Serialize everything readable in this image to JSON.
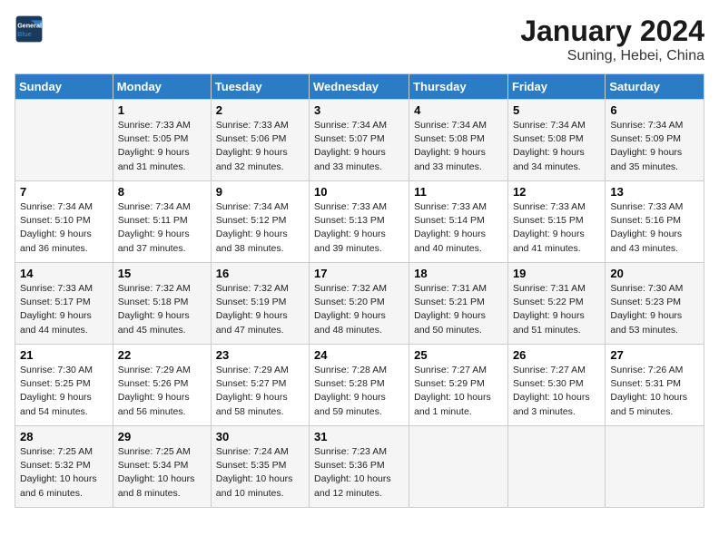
{
  "header": {
    "logo_line1": "General",
    "logo_line2": "Blue",
    "month": "January 2024",
    "location": "Suning, Hebei, China"
  },
  "weekdays": [
    "Sunday",
    "Monday",
    "Tuesday",
    "Wednesday",
    "Thursday",
    "Friday",
    "Saturday"
  ],
  "weeks": [
    [
      {
        "day": "",
        "info": ""
      },
      {
        "day": "1",
        "info": "Sunrise: 7:33 AM\nSunset: 5:05 PM\nDaylight: 9 hours\nand 31 minutes."
      },
      {
        "day": "2",
        "info": "Sunrise: 7:33 AM\nSunset: 5:06 PM\nDaylight: 9 hours\nand 32 minutes."
      },
      {
        "day": "3",
        "info": "Sunrise: 7:34 AM\nSunset: 5:07 PM\nDaylight: 9 hours\nand 33 minutes."
      },
      {
        "day": "4",
        "info": "Sunrise: 7:34 AM\nSunset: 5:08 PM\nDaylight: 9 hours\nand 33 minutes."
      },
      {
        "day": "5",
        "info": "Sunrise: 7:34 AM\nSunset: 5:08 PM\nDaylight: 9 hours\nand 34 minutes."
      },
      {
        "day": "6",
        "info": "Sunrise: 7:34 AM\nSunset: 5:09 PM\nDaylight: 9 hours\nand 35 minutes."
      }
    ],
    [
      {
        "day": "7",
        "info": "Sunrise: 7:34 AM\nSunset: 5:10 PM\nDaylight: 9 hours\nand 36 minutes."
      },
      {
        "day": "8",
        "info": "Sunrise: 7:34 AM\nSunset: 5:11 PM\nDaylight: 9 hours\nand 37 minutes."
      },
      {
        "day": "9",
        "info": "Sunrise: 7:34 AM\nSunset: 5:12 PM\nDaylight: 9 hours\nand 38 minutes."
      },
      {
        "day": "10",
        "info": "Sunrise: 7:33 AM\nSunset: 5:13 PM\nDaylight: 9 hours\nand 39 minutes."
      },
      {
        "day": "11",
        "info": "Sunrise: 7:33 AM\nSunset: 5:14 PM\nDaylight: 9 hours\nand 40 minutes."
      },
      {
        "day": "12",
        "info": "Sunrise: 7:33 AM\nSunset: 5:15 PM\nDaylight: 9 hours\nand 41 minutes."
      },
      {
        "day": "13",
        "info": "Sunrise: 7:33 AM\nSunset: 5:16 PM\nDaylight: 9 hours\nand 43 minutes."
      }
    ],
    [
      {
        "day": "14",
        "info": "Sunrise: 7:33 AM\nSunset: 5:17 PM\nDaylight: 9 hours\nand 44 minutes."
      },
      {
        "day": "15",
        "info": "Sunrise: 7:32 AM\nSunset: 5:18 PM\nDaylight: 9 hours\nand 45 minutes."
      },
      {
        "day": "16",
        "info": "Sunrise: 7:32 AM\nSunset: 5:19 PM\nDaylight: 9 hours\nand 47 minutes."
      },
      {
        "day": "17",
        "info": "Sunrise: 7:32 AM\nSunset: 5:20 PM\nDaylight: 9 hours\nand 48 minutes."
      },
      {
        "day": "18",
        "info": "Sunrise: 7:31 AM\nSunset: 5:21 PM\nDaylight: 9 hours\nand 50 minutes."
      },
      {
        "day": "19",
        "info": "Sunrise: 7:31 AM\nSunset: 5:22 PM\nDaylight: 9 hours\nand 51 minutes."
      },
      {
        "day": "20",
        "info": "Sunrise: 7:30 AM\nSunset: 5:23 PM\nDaylight: 9 hours\nand 53 minutes."
      }
    ],
    [
      {
        "day": "21",
        "info": "Sunrise: 7:30 AM\nSunset: 5:25 PM\nDaylight: 9 hours\nand 54 minutes."
      },
      {
        "day": "22",
        "info": "Sunrise: 7:29 AM\nSunset: 5:26 PM\nDaylight: 9 hours\nand 56 minutes."
      },
      {
        "day": "23",
        "info": "Sunrise: 7:29 AM\nSunset: 5:27 PM\nDaylight: 9 hours\nand 58 minutes."
      },
      {
        "day": "24",
        "info": "Sunrise: 7:28 AM\nSunset: 5:28 PM\nDaylight: 9 hours\nand 59 minutes."
      },
      {
        "day": "25",
        "info": "Sunrise: 7:27 AM\nSunset: 5:29 PM\nDaylight: 10 hours\nand 1 minute."
      },
      {
        "day": "26",
        "info": "Sunrise: 7:27 AM\nSunset: 5:30 PM\nDaylight: 10 hours\nand 3 minutes."
      },
      {
        "day": "27",
        "info": "Sunrise: 7:26 AM\nSunset: 5:31 PM\nDaylight: 10 hours\nand 5 minutes."
      }
    ],
    [
      {
        "day": "28",
        "info": "Sunrise: 7:25 AM\nSunset: 5:32 PM\nDaylight: 10 hours\nand 6 minutes."
      },
      {
        "day": "29",
        "info": "Sunrise: 7:25 AM\nSunset: 5:34 PM\nDaylight: 10 hours\nand 8 minutes."
      },
      {
        "day": "30",
        "info": "Sunrise: 7:24 AM\nSunset: 5:35 PM\nDaylight: 10 hours\nand 10 minutes."
      },
      {
        "day": "31",
        "info": "Sunrise: 7:23 AM\nSunset: 5:36 PM\nDaylight: 10 hours\nand 12 minutes."
      },
      {
        "day": "",
        "info": ""
      },
      {
        "day": "",
        "info": ""
      },
      {
        "day": "",
        "info": ""
      }
    ]
  ]
}
